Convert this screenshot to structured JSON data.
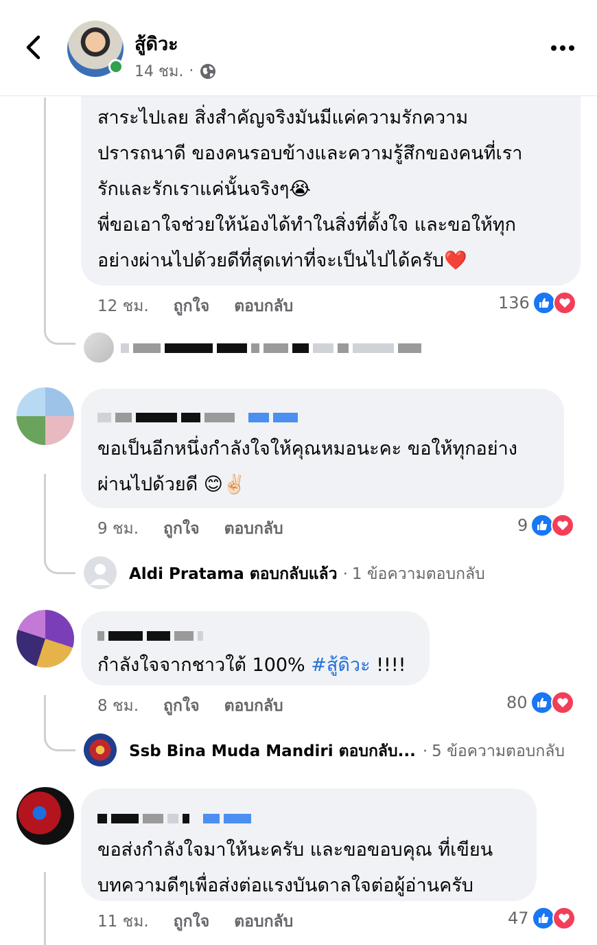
{
  "header": {
    "page_name": "สู้ดิวะ",
    "time": "14 ชม.",
    "separator": "·",
    "back_icon": "chevron-left-icon",
    "privacy_icon": "globe-icon",
    "more_icon": "more-horizontal-icon"
  },
  "comments": [
    {
      "text_lines": [
        "สาระไปเลย  สิ่งสำคัญจริงมันมีแค่ความรักความ",
        "ปรารถนาดี ของคนรอบข้างและความรู้สึกของคนที่เรา",
        "รักและรักเราแค่นั้นจริงๆ😭",
        "พี่ขอเอาใจช่วยให้น้องได้ทำในสิ่งที่ตั้งใจ และขอให้ทุก",
        "อย่างผ่านไปด้วยดีที่สุดเท่าที่จะเป็นไปได้ครับ❤️"
      ],
      "time": "12 ชม.",
      "like_label": "ถูกใจ",
      "reply_label": "ตอบกลับ",
      "reaction_count": "136"
    },
    {
      "text_lines": [
        "ขอเป็นอีกหนึ่งกำลังใจให้คุณหมอนะคะ ขอให้ทุกอย่าง",
        "ผ่านไปด้วยดี 😊✌🏻"
      ],
      "time": "9 ชม.",
      "like_label": "ถูกใจ",
      "reply_label": "ตอบกลับ",
      "reaction_count": "9",
      "reply_summary": {
        "name": "Aldi Pratama",
        "action": "ตอบกลับแล้ว",
        "separator": "·",
        "count": "1 ข้อความตอบกลับ"
      }
    },
    {
      "text_prefix": "กำลังใจจากชาวใต้ 100% ",
      "hashtag": "#สู้ดิวะ",
      "text_suffix": " !!!!",
      "time": "8 ชม.",
      "like_label": "ถูกใจ",
      "reply_label": "ตอบกลับ",
      "reaction_count": "80",
      "reply_summary": {
        "name": "Ssb Bina Muda Mandiri",
        "action": "ตอบกลับ...",
        "separator": "·",
        "count": "5 ข้อความตอบกลับ"
      }
    },
    {
      "text_lines": [
        "ขอส่งกำลังใจมาให้นะครับ  และขอขอบคุณ ที่เขียน",
        "บทความดีๆเพื่อส่งต่อแรงบันดาลใจต่อผู้อ่านครับ"
      ],
      "time": "11 ชม.",
      "like_label": "ถูกใจ",
      "reply_label": "ตอบกลับ",
      "reaction_count": "47"
    }
  ],
  "colors": {
    "like": "#1877f2",
    "love": "#f33e58",
    "hashtag": "#216fdb",
    "bubble": "#f0f2f5",
    "secondary_text": "#65676b"
  }
}
